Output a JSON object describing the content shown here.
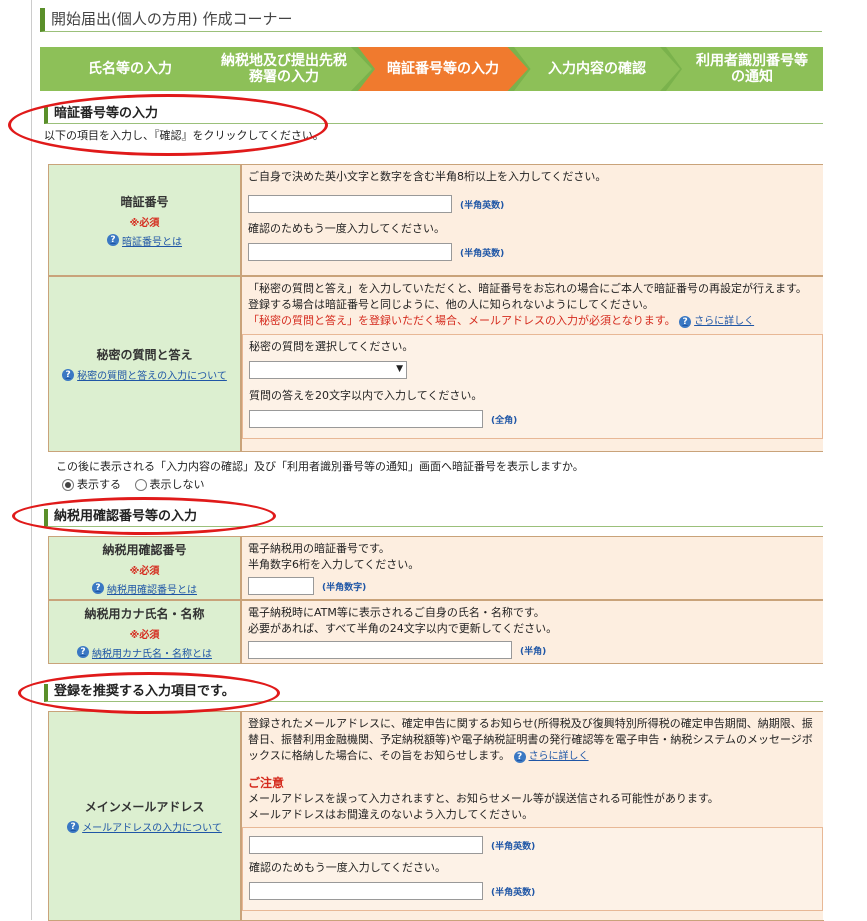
{
  "page_title": "開始届出(個人の方用) 作成コーナー",
  "steps": [
    {
      "label": "氏名等の入力",
      "state": "done"
    },
    {
      "label": "納税地及び提出先税務署の入力",
      "state": "done"
    },
    {
      "label": "暗証番号等の入力",
      "state": "active"
    },
    {
      "label": "入力内容の確認",
      "state": "todo"
    },
    {
      "label": "利用者識別番号等の通知",
      "state": "todo"
    }
  ],
  "section1": {
    "heading": "暗証番号等の入力",
    "instruction": "以下の項目を入力し、『確認』をクリックしてください。"
  },
  "pin": {
    "label": "暗証番号",
    "required": "※必須",
    "help_link": "暗証番号とは",
    "desc": "ご自身で決めた英小文字と数字を含む半角8桁以上を入力してください。",
    "hint": "(半角英数)",
    "confirm_desc": "確認のためもう一度入力してください。",
    "confirm_hint": "(半角英数)"
  },
  "secret": {
    "label": "秘密の質問と答え",
    "help_link": "秘密の質問と答えの入力について",
    "desc1": "「秘密の質問と答え」を入力していただくと、暗証番号をお忘れの場合にご本人で暗証番号の再設定が行えます。",
    "desc2": "登録する場合は暗証番号と同じように、他の人に知られないようにしてください。",
    "desc_red": "「秘密の質問と答え」を登録いただく場合、メールアドレスの入力が必須となります。",
    "more_link": "さらに詳しく",
    "select_label": "秘密の質問を選択してください。",
    "answer_label": "質問の答えを20文字以内で入力してください。",
    "answer_hint": "(全角)"
  },
  "display_question": "この後に表示される「入力内容の確認」及び「利用者識別番号等の通知」画面へ暗証番号を表示しますか。",
  "display_options": [
    {
      "label": "表示する",
      "checked": true
    },
    {
      "label": "表示しない",
      "checked": false
    }
  ],
  "section2": {
    "heading": "納税用確認番号等の入力"
  },
  "tax_pin": {
    "label": "納税用確認番号",
    "required": "※必須",
    "help_link": "納税用確認番号とは",
    "desc1": "電子納税用の暗証番号です。",
    "desc2": "半角数字6桁を入力してください。",
    "hint": "(半角数字)"
  },
  "kana_name": {
    "label": "納税用カナ氏名・名称",
    "required": "※必須",
    "help_link": "納税用カナ氏名・名称とは",
    "desc1": "電子納税時にATM等に表示されるご自身の氏名・名称です。",
    "desc2": "必要があれば、すべて半角の24文字以内で更新してください。",
    "hint": "(半角)"
  },
  "section3": {
    "heading": "登録を推奨する入力項目です。"
  },
  "email": {
    "label": "メインメールアドレス",
    "help_link": "メールアドレスの入力について",
    "desc": "登録されたメールアドレスに、確定申告に関するお知らせ(所得税及び復興特別所得税の確定申告期間、納期限、振替日、振替利用金融機関、予定納税額等)や電子納税証明書の発行確認等を電子申告・納税システムのメッセージボックスに格納した場合に、その旨をお知らせします。",
    "more_link": "さらに詳しく",
    "caution_title": "ご注意",
    "caution1": "メールアドレスを誤って入力されますと、お知らせメール等が誤送信される可能性があります。",
    "caution2": "メールアドレスはお間違えのないよう入力してください。",
    "hint": "(半角英数)",
    "confirm_desc": "確認のためもう一度入力してください。",
    "confirm_hint": "(半角英数)"
  }
}
